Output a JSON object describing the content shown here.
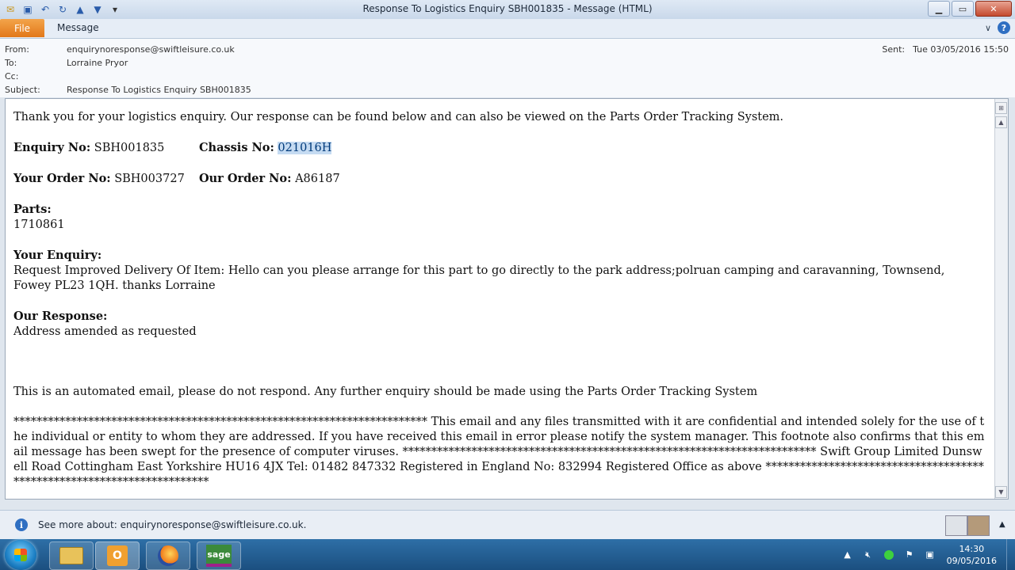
{
  "window": {
    "title": "Response To Logistics Enquiry SBH001835  -  Message (HTML)"
  },
  "ribbon": {
    "file_tab": "File",
    "message_tab": "Message"
  },
  "header": {
    "from_label": "From:",
    "from_value": "enquirynoresponse@swiftleisure.co.uk",
    "to_label": "To:",
    "to_value": "Lorraine Pryor",
    "cc_label": "Cc:",
    "cc_value": "",
    "subject_label": "Subject:",
    "subject_value": "Response To Logistics Enquiry SBH001835",
    "sent_label": "Sent:",
    "sent_value": "Tue 03/05/2016 15:50"
  },
  "email": {
    "intro": "Thank you for your logistics enquiry. Our response can be found below and can also be viewed on the Parts Order Tracking System.",
    "enquiry_no_label": "Enquiry No:",
    "enquiry_no_value": "SBH001835",
    "chassis_no_label": "Chassis No:",
    "chassis_no_value": "021016H",
    "your_order_label": "Your Order No:",
    "your_order_value": "SBH003727",
    "our_order_label": "Our Order No:",
    "our_order_value": "A86187",
    "parts_label": "Parts:",
    "parts_value": "1710861",
    "your_enquiry_label": "Your Enquiry:",
    "your_enquiry_value": "Request Improved Delivery Of Item: Hello can you please arrange for this part to go directly to the park address;polruan camping and caravanning, Townsend, Fowey PL23 1QH. thanks Lorraine",
    "our_response_label": "Our Response:",
    "our_response_value": "Address amended as requested",
    "automated_note": "This is an automated email, please do not respond. Any further enquiry should be made using the Parts Order Tracking System",
    "footer": "************************************************************************ This email and any files transmitted with it are confidential and intended solely for the use of the individual or entity to whom they are addressed. If you have received this email in error please notify the system manager. This footnote also confirms that this email message has been swept for the presence of computer viruses. ************************************************************************ Swift Group Limited Dunswell Road Cottingham East Yorkshire HU16 4JX Tel: 01482 847332 Registered in England No: 832994 Registered Office as above ************************************************************************"
  },
  "people_pane": {
    "see_more": "See more about: enquirynoresponse@swiftleisure.co.uk."
  },
  "taskbar": {
    "time": "14:30",
    "date": "09/05/2016",
    "sage_label": "sage"
  },
  "colors": {
    "file_tab": "#e2781a",
    "selection": "#c5dbf2",
    "taskbar": "#1b4f80"
  }
}
